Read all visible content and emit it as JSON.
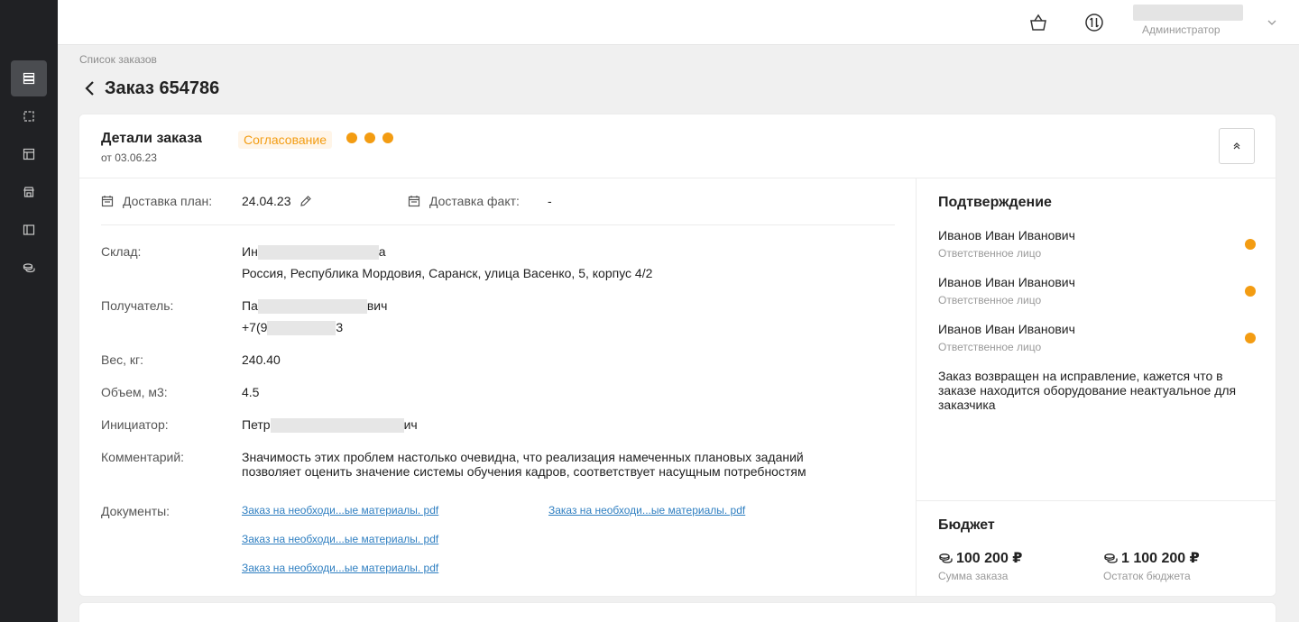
{
  "header": {
    "user_role": "Администратор"
  },
  "breadcrumb": "Список заказов",
  "page_title": "Заказ 654786",
  "order": {
    "title": "Детали заказа",
    "date": "от 03.06.23",
    "status": "Согласование",
    "status_color": "#f39c12",
    "delivery_plan_label": "Доставка план:",
    "delivery_plan_value": "24.04.23",
    "delivery_fact_label": "Доставка факт:",
    "delivery_fact_value": "-",
    "warehouse_label": "Склад:",
    "warehouse_name_start": "Ин",
    "warehouse_name_end": "а",
    "warehouse_address": "Россия, Республика Мордовия, Саранск, улица Васенко, 5, корпус 4/2",
    "recipient_label": "Получатель:",
    "recipient_name_start": "Па",
    "recipient_name_end": "вич",
    "recipient_phone_start": "+7(9",
    "recipient_phone_end": "3",
    "weight_label": "Вес, кг:",
    "weight_value": "240.40",
    "volume_label": "Объем, м3:",
    "volume_value": "4.5",
    "initiator_label": "Инициатор:",
    "initiator_start": "Петр",
    "initiator_end": "ич",
    "comment_label": "Комментарий:",
    "comment_line1": "Значимость этих проблем настолько очевидна, что реализация намеченных плановых заданий",
    "comment_line2": "позволяет оценить значение системы обучения кадров, соответствует насущным потребностям",
    "documents_label": "Документы:",
    "documents": [
      "Заказ на необходи...ые материалы. pdf",
      "Заказ на необходи...ые материалы. pdf",
      "Заказ на необходи...ые материалы. pdf",
      "Заказ на необходи...ые материалы. pdf"
    ]
  },
  "confirmation": {
    "title": "Подтверждение",
    "approvers": [
      {
        "name": "Иванов Иван Иванович",
        "role": "Ответственное лицо"
      },
      {
        "name": "Иванов Иван Иванович",
        "role": "Ответственное лицо"
      },
      {
        "name": "Иванов Иван Иванович",
        "role": "Ответственное лицо"
      }
    ],
    "note": "Заказ возвращен на исправление, кажется что в заказе находится оборудование неактуальное для заказчика"
  },
  "budget": {
    "title": "Бюджет",
    "order_sum": "100 200 ₽",
    "order_sum_label": "Сумма заказа",
    "remaining": "1 100 200 ₽",
    "remaining_label": "Остаток бюджета"
  }
}
